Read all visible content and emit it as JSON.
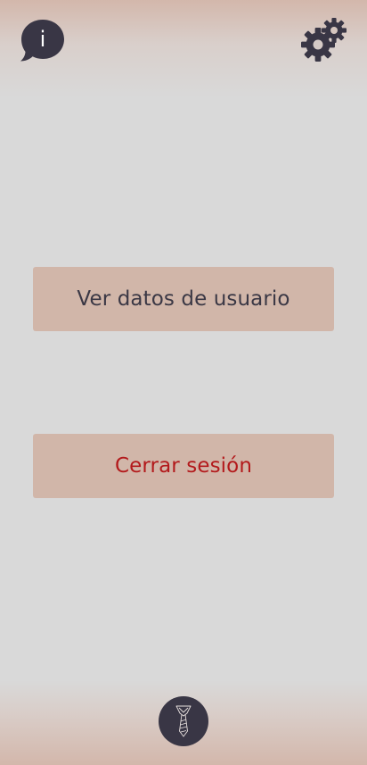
{
  "header": {
    "info_icon": "info-speech-bubble-icon",
    "info_glyph": "i",
    "settings_icon": "gears-icon"
  },
  "main": {
    "view_user_data_label": "Ver datos de usuario",
    "logout_label": "Cerrar sesión"
  },
  "footer": {
    "logo_icon": "tie-icon"
  },
  "colors": {
    "background": "#d9d9d9",
    "accent": "#d1b6a9",
    "icon_dark": "#393645",
    "text_dark": "#3b3845",
    "danger_text": "#b31a1c"
  }
}
